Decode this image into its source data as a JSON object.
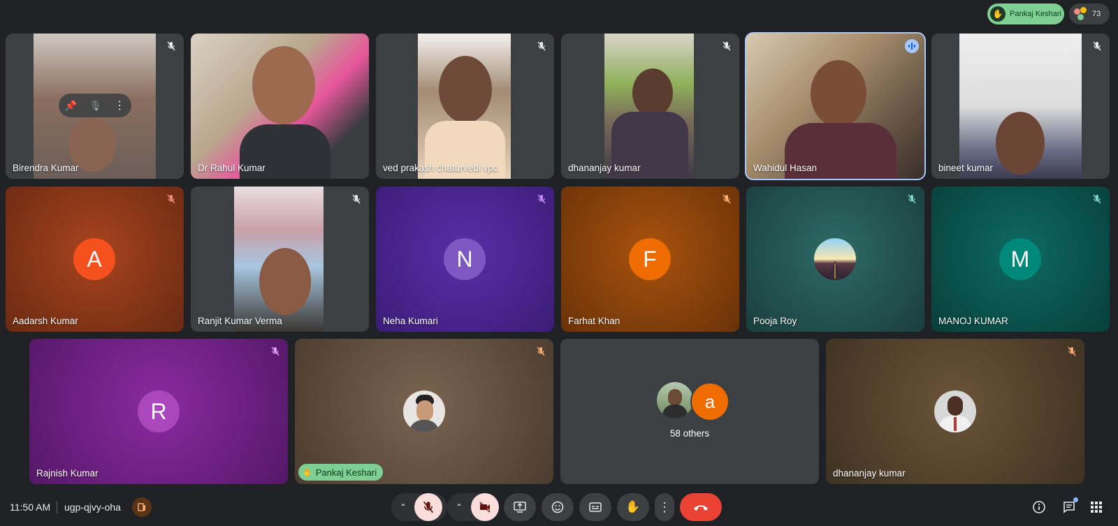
{
  "top": {
    "raised_hand_name": "Pankaj Keshari",
    "participant_count": "73"
  },
  "tiles": {
    "t1": {
      "name": "Birendra Kumar"
    },
    "t2": {
      "name": "Dr Rahul Kumar"
    },
    "t3": {
      "name": "ved prakash chaturvedi vpc"
    },
    "t4": {
      "name": "dhananjay kumar"
    },
    "t5": {
      "name": "Wahidul Hasan"
    },
    "t6": {
      "name": "bineet kumar"
    },
    "t7": {
      "name": "Aadarsh Kumar",
      "initial": "A"
    },
    "t8": {
      "name": "Ranjit Kumar Verma"
    },
    "t9": {
      "name": "Neha Kumari",
      "initial": "N"
    },
    "t10": {
      "name": "Farhat Khan",
      "initial": "F"
    },
    "t11": {
      "name": "Pooja Roy"
    },
    "t12": {
      "name": "MANOJ KUMAR",
      "initial": "M"
    },
    "t13": {
      "name": "Rajnish Kumar",
      "initial": "R"
    },
    "t14": {
      "name": "Pankaj Keshari"
    },
    "t15": {
      "others_label": "58 others",
      "initial": "a"
    },
    "t16": {
      "name": "dhananjay kumar"
    }
  },
  "bottom": {
    "time": "11:50 AM",
    "meeting_code": "ugp-qjvy-oha"
  },
  "colors": {
    "accent_hand": "#7fcf95",
    "end_call": "#ea4335",
    "active_border": "#a8c7fa",
    "muted_bg": "#f9dedc"
  }
}
